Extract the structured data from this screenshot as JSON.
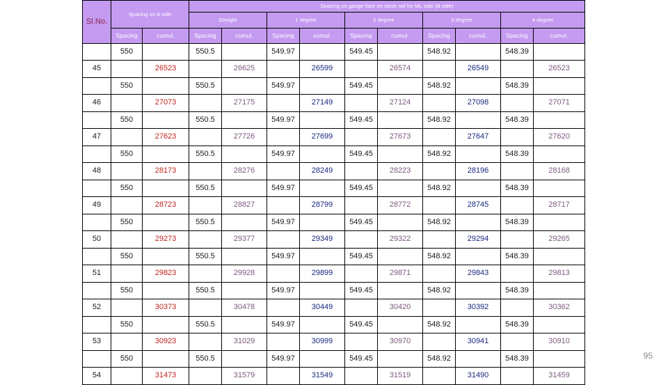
{
  "slide": {
    "page_number": "95"
  },
  "table": {
    "header": {
      "sl_no": "Sl.No.",
      "a_side_group": "Spacing on A side",
      "b_side_band": "Spacing on gauge face on stock rail for ML side (B side)",
      "degree_groups": [
        "Straight",
        "1 degree",
        "2 degree",
        "3 degree",
        "4 degree"
      ],
      "sub_spacing": "Spacing",
      "sub_cumul": "cumul."
    },
    "colors": {
      "header_bg": "#c49bf0",
      "header_text": "#ffffff",
      "sl_no_text": "#8e1f4a",
      "cumul_red": "#c0241f",
      "cumul_mauve": "#7b5a7e",
      "cumul_navy": "#19277e",
      "body_text": "#1a1a1a",
      "border": "#000000",
      "page_number": "#8a8a8a"
    },
    "spacing_values": [
      "550",
      "550.5",
      "549.97",
      "549.45",
      "548.92",
      "548.39"
    ],
    "cumul_color_order": [
      "c-red",
      "c-mauve",
      "c-navy",
      "c-mauve",
      "c-navy",
      "c-mauve"
    ],
    "rows": [
      {
        "sl": "45",
        "spacings": [
          "550",
          "550.5",
          "549.97",
          "549.45",
          "548.92",
          "548.39"
        ],
        "cumuls": [
          "26523",
          "26625",
          "26599",
          "26574",
          "26549",
          "26523"
        ]
      },
      {
        "sl": "46",
        "spacings": [
          "550",
          "550.5",
          "549.97",
          "549.45",
          "548.92",
          "548.39"
        ],
        "cumuls": [
          "27073",
          "27175",
          "27149",
          "27124",
          "27098",
          "27071"
        ]
      },
      {
        "sl": "47",
        "spacings": [
          "550",
          "550.5",
          "549.97",
          "549.45",
          "548.92",
          "548.39"
        ],
        "cumuls": [
          "27623",
          "27726",
          "27699",
          "27673",
          "27647",
          "27620"
        ]
      },
      {
        "sl": "48",
        "spacings": [
          "550",
          "550.5",
          "549.97",
          "549.45",
          "548.92",
          "548.39"
        ],
        "cumuls": [
          "28173",
          "28276",
          "28249",
          "28223",
          "28196",
          "28168"
        ]
      },
      {
        "sl": "49",
        "spacings": [
          "550",
          "550.5",
          "549.97",
          "549.45",
          "548.92",
          "548.39"
        ],
        "cumuls": [
          "28723",
          "28827",
          "28799",
          "28772",
          "28745",
          "28717"
        ]
      },
      {
        "sl": "50",
        "spacings": [
          "550",
          "550.5",
          "549.97",
          "549.45",
          "548.92",
          "548.39"
        ],
        "cumuls": [
          "29273",
          "29377",
          "29349",
          "29322",
          "29294",
          "29265"
        ]
      },
      {
        "sl": "51",
        "spacings": [
          "550",
          "550.5",
          "549.97",
          "549.45",
          "548.92",
          "548.39"
        ],
        "cumuls": [
          "29823",
          "29928",
          "29899",
          "29871",
          "29843",
          "29813"
        ]
      },
      {
        "sl": "52",
        "spacings": [
          "550",
          "550.5",
          "549.97",
          "549.45",
          "548.92",
          "548.39"
        ],
        "cumuls": [
          "30373",
          "30478",
          "30449",
          "30420",
          "30392",
          "30362"
        ]
      },
      {
        "sl": "53",
        "spacings": [
          "550",
          "550.5",
          "549.97",
          "549.45",
          "548.92",
          "548.39"
        ],
        "cumuls": [
          "30923",
          "31029",
          "30999",
          "30970",
          "30941",
          "30910"
        ]
      },
      {
        "sl": "54",
        "spacings": [
          "550",
          "550.5",
          "549.97",
          "549.45",
          "548.92",
          "548.39"
        ],
        "cumuls": [
          "31473",
          "31579",
          "31549",
          "31519",
          "31490",
          "31459"
        ]
      }
    ]
  }
}
